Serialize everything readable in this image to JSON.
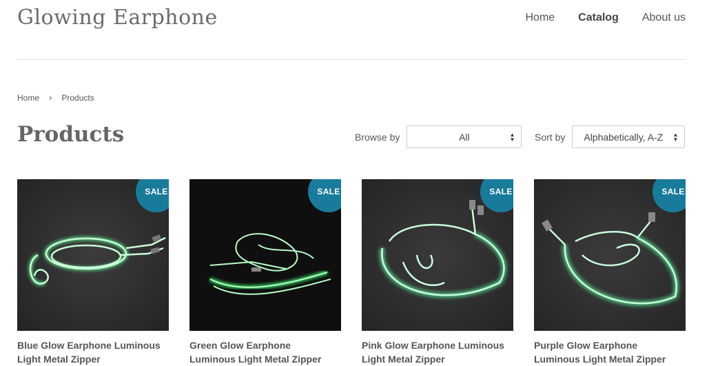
{
  "site": {
    "title": "Glowing Earphone"
  },
  "nav": {
    "items": [
      "Home",
      "Catalog",
      "About us"
    ],
    "active": "Catalog"
  },
  "breadcrumb": {
    "home": "Home",
    "separator": "›",
    "current": "Products"
  },
  "page": {
    "title": "Products"
  },
  "filters": {
    "browse_label": "Browse by",
    "browse_value": "All",
    "sort_label": "Sort by",
    "sort_value": "Alphabetically, A-Z"
  },
  "products": [
    {
      "badge": "SALE",
      "title_line1": "Blue Glow Earphone Luminous",
      "title_line2": "Light Metal Zipper"
    },
    {
      "badge": "SALE",
      "title_line1": "Green Glow Earphone",
      "title_line2": "Luminous Light Metal Zipper"
    },
    {
      "badge": "SALE",
      "title_line1": "Pink Glow Earphone Luminous",
      "title_line2": "Light Metal Zipper"
    },
    {
      "badge": "SALE",
      "title_line1": "Purple Glow Earphone",
      "title_line2": "Luminous Light Metal Zipper"
    }
  ],
  "colors": {
    "sale_badge": "#197b9b",
    "glow": "#8dffb0",
    "rule": "#e2e2e2"
  }
}
